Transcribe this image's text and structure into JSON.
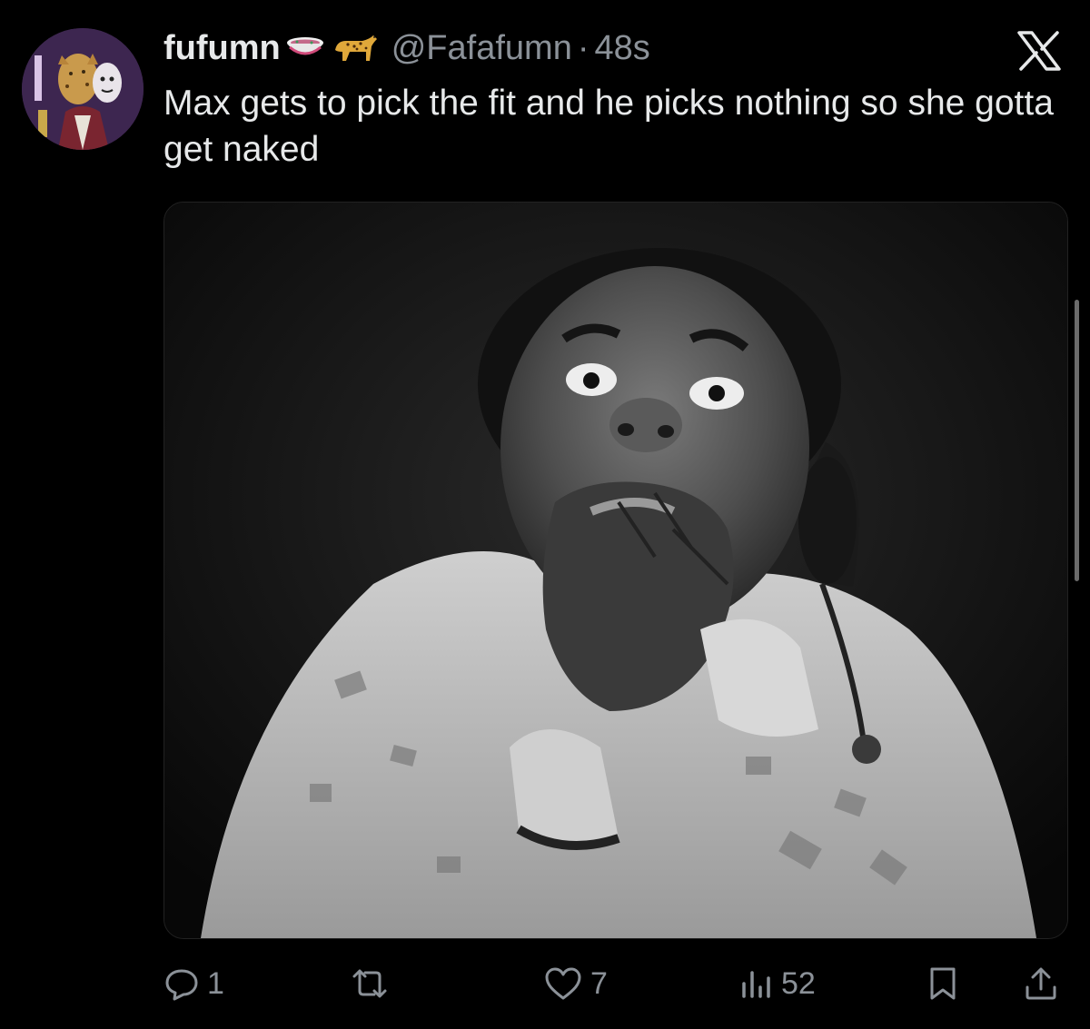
{
  "tweet": {
    "display_name": "fufumn",
    "name_emojis": [
      "bowl-emoji",
      "leopard-emoji"
    ],
    "handle": "@Fafafumn",
    "separator": "·",
    "time": "48s",
    "text": "Max gets to pick the fit and he picks nothing so she gotta get naked"
  },
  "actions": {
    "reply_count": "1",
    "repost_count": "",
    "like_count": "7",
    "view_count": "52"
  },
  "icons": {
    "brand": "x-logo",
    "reply": "reply-icon",
    "repost": "repost-icon",
    "like": "heart-icon",
    "views": "views-icon",
    "bookmark": "bookmark-icon",
    "share": "share-icon"
  },
  "colors": {
    "background": "#000000",
    "text": "#e7e9ea",
    "muted": "#8b9198"
  }
}
